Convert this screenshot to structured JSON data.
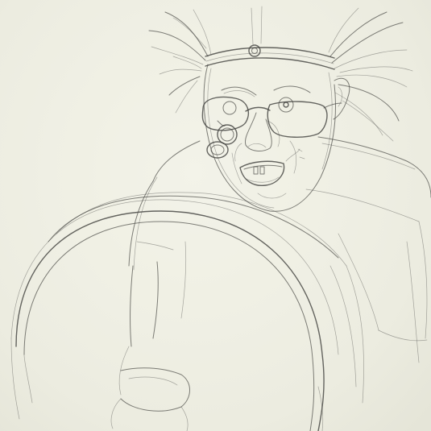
{
  "image": {
    "kind": "pencil sketch",
    "colors": {
      "paper": "#f1f1e6",
      "graphite": "#4a4a46"
    }
  }
}
